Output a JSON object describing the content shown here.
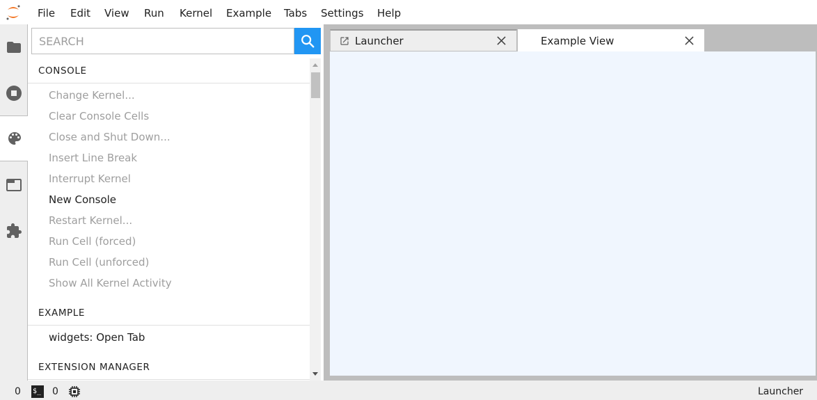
{
  "menubar": {
    "items": [
      "File",
      "Edit",
      "View",
      "Run",
      "Kernel",
      "Example",
      "Tabs",
      "Settings",
      "Help"
    ]
  },
  "left_strip": {
    "icons": [
      "folder-icon",
      "running-icon",
      "palette-icon",
      "tabs-icon",
      "extension-icon"
    ],
    "active": "palette-icon"
  },
  "palette": {
    "search": {
      "placeholder": "SEARCH",
      "value": ""
    },
    "categories": [
      {
        "name": "CONSOLE",
        "commands": [
          {
            "label": "Change Kernel...",
            "enabled": false
          },
          {
            "label": "Clear Console Cells",
            "enabled": false
          },
          {
            "label": "Close and Shut Down...",
            "enabled": false
          },
          {
            "label": "Insert Line Break",
            "enabled": false
          },
          {
            "label": "Interrupt Kernel",
            "enabled": false
          },
          {
            "label": "New Console",
            "enabled": true
          },
          {
            "label": "Restart Kernel...",
            "enabled": false
          },
          {
            "label": "Run Cell (forced)",
            "enabled": false
          },
          {
            "label": "Run Cell (unforced)",
            "enabled": false
          },
          {
            "label": "Show All Kernel Activity",
            "enabled": false
          }
        ]
      },
      {
        "name": "EXAMPLE",
        "commands": [
          {
            "label": "widgets: Open Tab",
            "enabled": true
          }
        ]
      },
      {
        "name": "EXTENSION MANAGER",
        "commands": []
      }
    ]
  },
  "tabs": [
    {
      "label": "Launcher",
      "icon": "launch-icon",
      "active": false
    },
    {
      "label": "Example View",
      "icon": "",
      "active": true
    }
  ],
  "statusbar": {
    "terminals_count": "0",
    "kernels_count": "0",
    "terminal_icon_text": "$_",
    "current_activity": "Launcher"
  },
  "colors": {
    "accent": "#2196f3",
    "logo": "#f37726",
    "content_bg": "#f0f6fe",
    "disabled_text": "#9e9e9e"
  }
}
